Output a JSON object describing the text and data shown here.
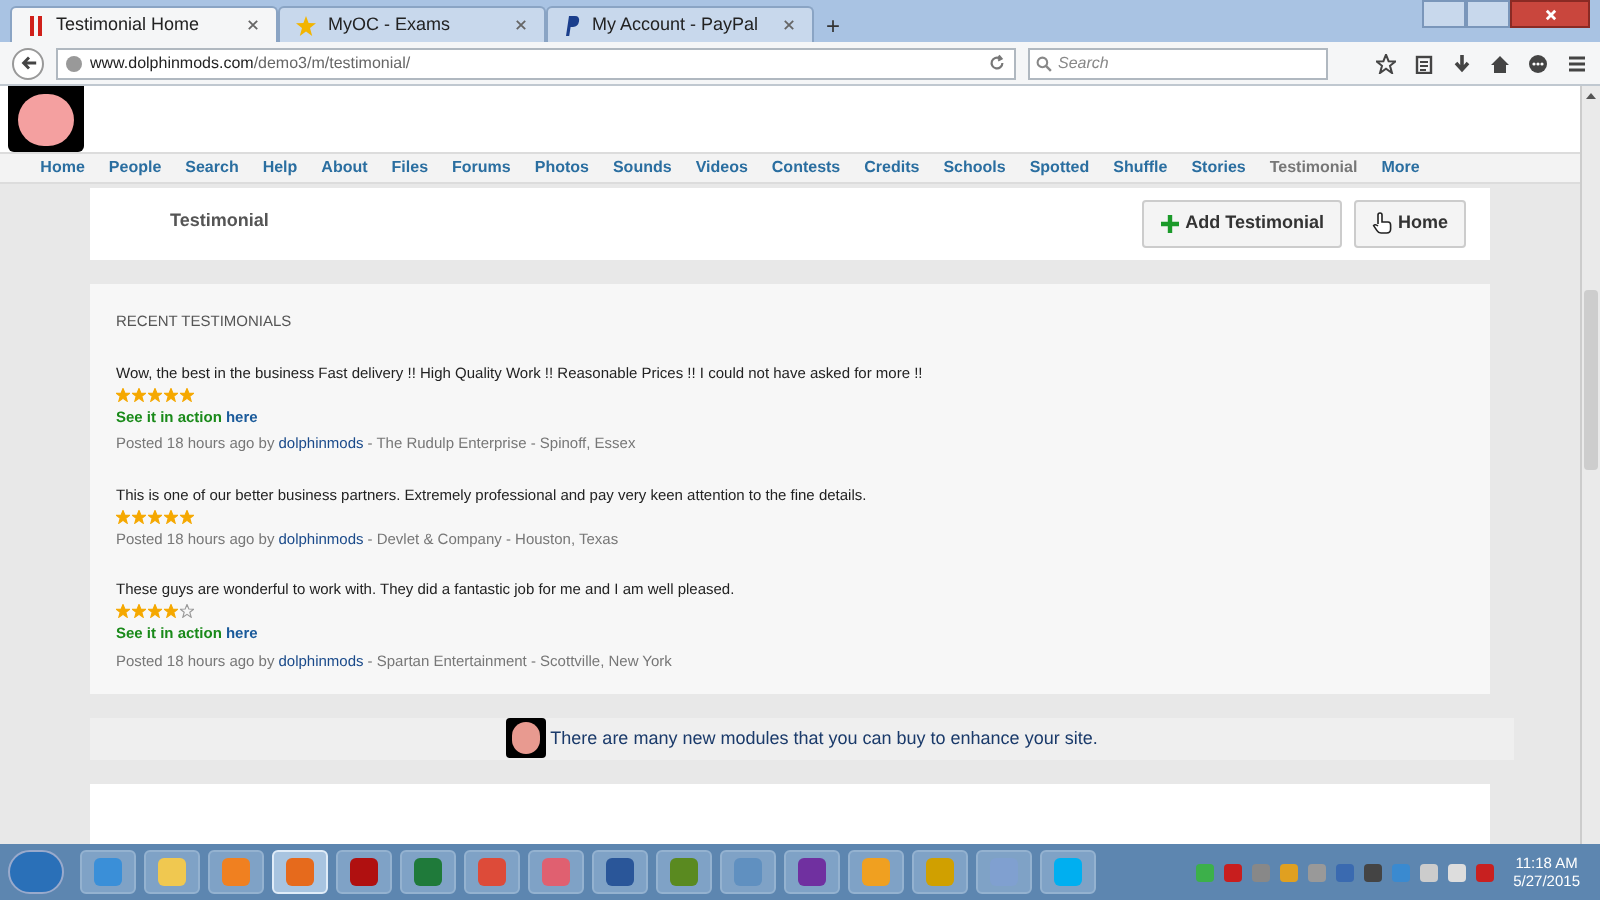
{
  "browser": {
    "tabs": [
      {
        "title": "Testimonial Home",
        "selected": true,
        "kind": "bars"
      },
      {
        "title": "MyOC - Exams",
        "selected": false,
        "kind": "star"
      },
      {
        "title": "My Account - PayPal",
        "selected": false,
        "kind": "paypal"
      }
    ],
    "new_tab": "+",
    "url_host": "www.dolphinmods.com",
    "url_path": "/demo3/m/testimonial/",
    "search_placeholder": "Search"
  },
  "nav": [
    {
      "label": "Home",
      "selected": false
    },
    {
      "label": "People",
      "selected": false
    },
    {
      "label": "Search",
      "selected": false
    },
    {
      "label": "Help",
      "selected": false
    },
    {
      "label": "About",
      "selected": false
    },
    {
      "label": "Files",
      "selected": false
    },
    {
      "label": "Forums",
      "selected": false
    },
    {
      "label": "Photos",
      "selected": false
    },
    {
      "label": "Sounds",
      "selected": false
    },
    {
      "label": "Videos",
      "selected": false
    },
    {
      "label": "Contests",
      "selected": false
    },
    {
      "label": "Credits",
      "selected": false
    },
    {
      "label": "Schools",
      "selected": false
    },
    {
      "label": "Spotted",
      "selected": false
    },
    {
      "label": "Shuffle",
      "selected": false
    },
    {
      "label": "Stories",
      "selected": false
    },
    {
      "label": "Testimonial",
      "selected": true
    },
    {
      "label": "More",
      "selected": false
    }
  ],
  "page_title": "Testimonial",
  "buttons": [
    {
      "label": "Add Testimonial",
      "kind": "add"
    },
    {
      "label": "Home",
      "kind": "hand"
    }
  ],
  "section_heading": "RECENT TESTIMONIALS",
  "testimonials": [
    {
      "text": "Wow, the best in the business Fast delivery !! High Quality Work !! Reasonable Prices !! I could not have asked for more !!",
      "stars": 5,
      "action_label": "See it in action",
      "action_link": "here",
      "posted": "Posted 18 hours ago by",
      "author": "dolphinmods",
      "details": "- The Rudulp Enterprise - Spinoff, Essex"
    },
    {
      "text": "This is one of our better business partners. Extremely professional and pay very keen attention to the fine details.",
      "stars": 5,
      "posted": "Posted 18 hours ago by",
      "author": "dolphinmods",
      "details": "- Devlet & Company - Houston, Texas"
    },
    {
      "text": "These guys are wonderful to work with. They did a fantastic job for me and I am well pleased.",
      "stars": 4,
      "action_label": "See it in action",
      "action_link": "here",
      "posted": "Posted 18 hours ago by",
      "author": "dolphinmods",
      "details": "- Spartan Entertainment - Scottville, New York"
    }
  ],
  "banner": "There are many new modules that you can buy to enhance your site.",
  "taskbar": {
    "apps": [
      {
        "kind": "ie",
        "selected": false
      },
      {
        "kind": "folder",
        "selected": false
      },
      {
        "kind": "media",
        "selected": false
      },
      {
        "kind": "firefox",
        "selected": true
      },
      {
        "kind": "filezilla",
        "selected": false
      },
      {
        "kind": "excel",
        "selected": false
      },
      {
        "kind": "chrome",
        "selected": false
      },
      {
        "kind": "eraser",
        "selected": false
      },
      {
        "kind": "word",
        "selected": false
      },
      {
        "kind": "frog",
        "selected": false
      },
      {
        "kind": "ab",
        "selected": false
      },
      {
        "kind": "arrow",
        "selected": false
      },
      {
        "kind": "monitor",
        "selected": false
      },
      {
        "kind": "ue",
        "selected": false
      },
      {
        "kind": "paint",
        "selected": false
      },
      {
        "kind": "skype",
        "selected": false
      }
    ],
    "time": "11:18 AM",
    "date": "5/27/2015"
  }
}
